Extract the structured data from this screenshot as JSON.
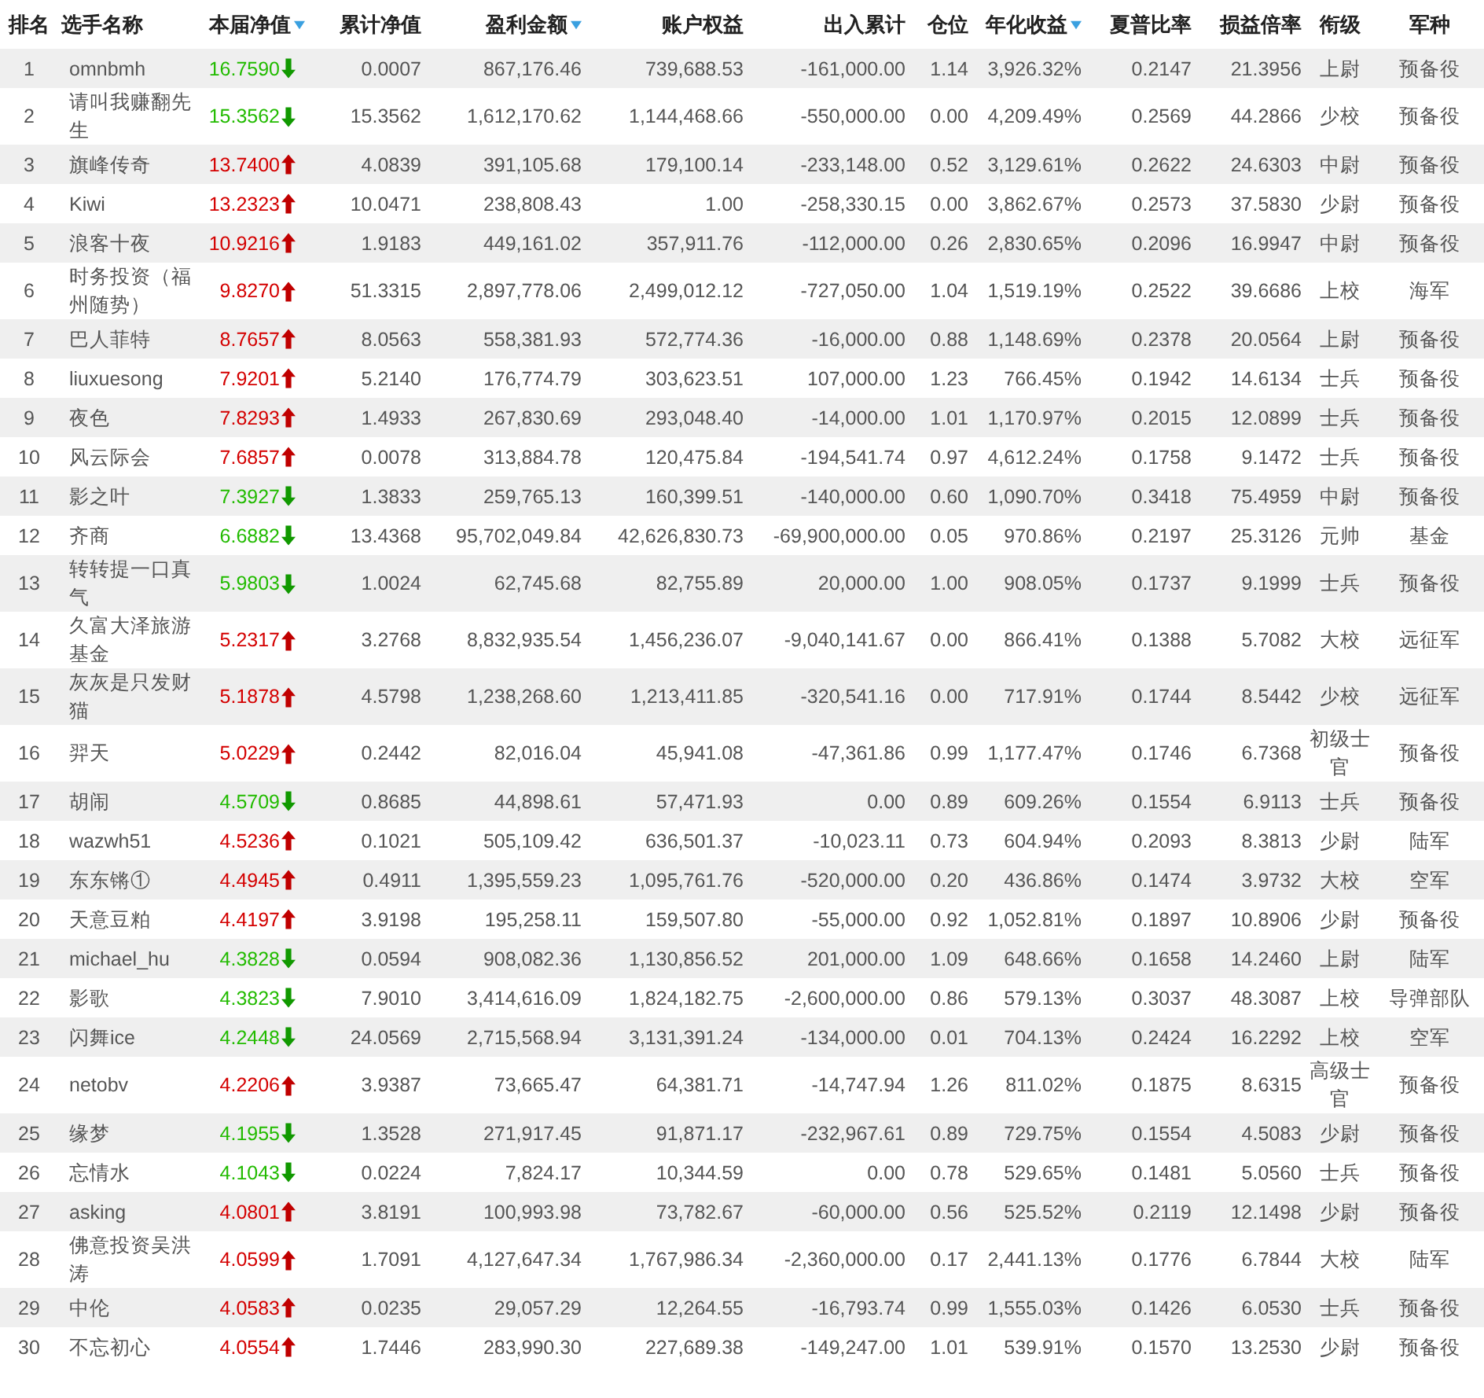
{
  "table": {
    "columns": [
      {
        "label": "排名",
        "sortable": false
      },
      {
        "label": "选手名称",
        "sortable": false
      },
      {
        "label": "本届净值",
        "sortable": true
      },
      {
        "label": "累计净值",
        "sortable": false
      },
      {
        "label": "盈利金额",
        "sortable": true
      },
      {
        "label": "账户权益",
        "sortable": false
      },
      {
        "label": "出入累计",
        "sortable": false
      },
      {
        "label": "仓位",
        "sortable": false
      },
      {
        "label": "年化收益",
        "sortable": true
      },
      {
        "label": "夏普比率",
        "sortable": false
      },
      {
        "label": "损益倍率",
        "sortable": false
      },
      {
        "label": "衔级",
        "sortable": false
      },
      {
        "label": "军种",
        "sortable": false
      }
    ],
    "rows": [
      {
        "rising": false,
        "cells": [
          "1",
          "omnbmh",
          "16.7590",
          "0.0007",
          "867,176.46",
          "739,688.53",
          "-161,000.00",
          "1.14",
          "3,926.32%",
          "0.2147",
          "21.3956",
          "上尉",
          "预备役"
        ]
      },
      {
        "rising": false,
        "cells": [
          "2",
          "请叫我赚翻先生",
          "15.3562",
          "15.3562",
          "1,612,170.62",
          "1,144,468.66",
          "-550,000.00",
          "0.00",
          "4,209.49%",
          "0.2569",
          "44.2866",
          "少校",
          "预备役"
        ]
      },
      {
        "rising": true,
        "cells": [
          "3",
          "旗峰传奇",
          "13.7400",
          "4.0839",
          "391,105.68",
          "179,100.14",
          "-233,148.00",
          "0.52",
          "3,129.61%",
          "0.2622",
          "24.6303",
          "中尉",
          "预备役"
        ]
      },
      {
        "rising": true,
        "cells": [
          "4",
          "Kiwi",
          "13.2323",
          "10.0471",
          "238,808.43",
          "1.00",
          "-258,330.15",
          "0.00",
          "3,862.67%",
          "0.2573",
          "37.5830",
          "少尉",
          "预备役"
        ]
      },
      {
        "rising": true,
        "cells": [
          "5",
          "浪客十夜",
          "10.9216",
          "1.9183",
          "449,161.02",
          "357,911.76",
          "-112,000.00",
          "0.26",
          "2,830.65%",
          "0.2096",
          "16.9947",
          "中尉",
          "预备役"
        ]
      },
      {
        "rising": true,
        "cells": [
          "6",
          "时务投资（福州随势）",
          "9.8270",
          "51.3315",
          "2,897,778.06",
          "2,499,012.12",
          "-727,050.00",
          "1.04",
          "1,519.19%",
          "0.2522",
          "39.6686",
          "上校",
          "海军"
        ]
      },
      {
        "rising": true,
        "cells": [
          "7",
          "巴人菲特",
          "8.7657",
          "8.0563",
          "558,381.93",
          "572,774.36",
          "-16,000.00",
          "0.88",
          "1,148.69%",
          "0.2378",
          "20.0564",
          "上尉",
          "预备役"
        ]
      },
      {
        "rising": true,
        "cells": [
          "8",
          "liuxuesong",
          "7.9201",
          "5.2140",
          "176,774.79",
          "303,623.51",
          "107,000.00",
          "1.23",
          "766.45%",
          "0.1942",
          "14.6134",
          "士兵",
          "预备役"
        ]
      },
      {
        "rising": true,
        "cells": [
          "9",
          "夜色",
          "7.8293",
          "1.4933",
          "267,830.69",
          "293,048.40",
          "-14,000.00",
          "1.01",
          "1,170.97%",
          "0.2015",
          "12.0899",
          "士兵",
          "预备役"
        ]
      },
      {
        "rising": true,
        "cells": [
          "10",
          "风云际会",
          "7.6857",
          "0.0078",
          "313,884.78",
          "120,475.84",
          "-194,541.74",
          "0.97",
          "4,612.24%",
          "0.1758",
          "9.1472",
          "士兵",
          "预备役"
        ]
      },
      {
        "rising": false,
        "cells": [
          "11",
          "影之叶",
          "7.3927",
          "1.3833",
          "259,765.13",
          "160,399.51",
          "-140,000.00",
          "0.60",
          "1,090.70%",
          "0.3418",
          "75.4959",
          "中尉",
          "预备役"
        ]
      },
      {
        "rising": false,
        "cells": [
          "12",
          "齐商",
          "6.6882",
          "13.4368",
          "95,702,049.84",
          "42,626,830.73",
          "-69,900,000.00",
          "0.05",
          "970.86%",
          "0.2197",
          "25.3126",
          "元帅",
          "基金"
        ]
      },
      {
        "rising": false,
        "cells": [
          "13",
          "转转提一口真气",
          "5.9803",
          "1.0024",
          "62,745.68",
          "82,755.89",
          "20,000.00",
          "1.00",
          "908.05%",
          "0.1737",
          "9.1999",
          "士兵",
          "预备役"
        ]
      },
      {
        "rising": true,
        "cells": [
          "14",
          "久富大泽旅游基金",
          "5.2317",
          "3.2768",
          "8,832,935.54",
          "1,456,236.07",
          "-9,040,141.67",
          "0.00",
          "866.41%",
          "0.1388",
          "5.7082",
          "大校",
          "远征军"
        ]
      },
      {
        "rising": true,
        "cells": [
          "15",
          "灰灰是只发财猫",
          "5.1878",
          "4.5798",
          "1,238,268.60",
          "1,213,411.85",
          "-320,541.16",
          "0.00",
          "717.91%",
          "0.1744",
          "8.5442",
          "少校",
          "远征军"
        ]
      },
      {
        "rising": true,
        "cells": [
          "16",
          "羿天",
          "5.0229",
          "0.2442",
          "82,016.04",
          "45,941.08",
          "-47,361.86",
          "0.99",
          "1,177.47%",
          "0.1746",
          "6.7368",
          "初级士官",
          "预备役"
        ]
      },
      {
        "rising": false,
        "cells": [
          "17",
          "胡闹",
          "4.5709",
          "0.8685",
          "44,898.61",
          "57,471.93",
          "0.00",
          "0.89",
          "609.26%",
          "0.1554",
          "6.9113",
          "士兵",
          "预备役"
        ]
      },
      {
        "rising": true,
        "cells": [
          "18",
          "wazwh51",
          "4.5236",
          "0.1021",
          "505,109.42",
          "636,501.37",
          "-10,023.11",
          "0.73",
          "604.94%",
          "0.2093",
          "8.3813",
          "少尉",
          "陆军"
        ]
      },
      {
        "rising": true,
        "cells": [
          "19",
          "东东锵①",
          "4.4945",
          "0.4911",
          "1,395,559.23",
          "1,095,761.76",
          "-520,000.00",
          "0.20",
          "436.86%",
          "0.1474",
          "3.9732",
          "大校",
          "空军"
        ]
      },
      {
        "rising": true,
        "cells": [
          "20",
          "天意豆粕",
          "4.4197",
          "3.9198",
          "195,258.11",
          "159,507.80",
          "-55,000.00",
          "0.92",
          "1,052.81%",
          "0.1897",
          "10.8906",
          "少尉",
          "预备役"
        ]
      },
      {
        "rising": false,
        "cells": [
          "21",
          "michael_hu",
          "4.3828",
          "0.0594",
          "908,082.36",
          "1,130,856.52",
          "201,000.00",
          "1.09",
          "648.66%",
          "0.1658",
          "14.2460",
          "上尉",
          "陆军"
        ]
      },
      {
        "rising": false,
        "cells": [
          "22",
          "影歌",
          "4.3823",
          "7.9010",
          "3,414,616.09",
          "1,824,182.75",
          "-2,600,000.00",
          "0.86",
          "579.13%",
          "0.3037",
          "48.3087",
          "上校",
          "导弹部队"
        ]
      },
      {
        "rising": false,
        "cells": [
          "23",
          "闪舞ice",
          "4.2448",
          "24.0569",
          "2,715,568.94",
          "3,131,391.24",
          "-134,000.00",
          "0.01",
          "704.13%",
          "0.2424",
          "16.2292",
          "上校",
          "空军"
        ]
      },
      {
        "rising": true,
        "cells": [
          "24",
          "netobv",
          "4.2206",
          "3.9387",
          "73,665.47",
          "64,381.71",
          "-14,747.94",
          "1.26",
          "811.02%",
          "0.1875",
          "8.6315",
          "高级士官",
          "预备役"
        ]
      },
      {
        "rising": false,
        "cells": [
          "25",
          "缘梦",
          "4.1955",
          "1.3528",
          "271,917.45",
          "91,871.17",
          "-232,967.61",
          "0.89",
          "729.75%",
          "0.1554",
          "4.5083",
          "少尉",
          "预备役"
        ]
      },
      {
        "rising": false,
        "cells": [
          "26",
          "忘情水",
          "4.1043",
          "0.0224",
          "7,824.17",
          "10,344.59",
          "0.00",
          "0.78",
          "529.65%",
          "0.1481",
          "5.0560",
          "士兵",
          "预备役"
        ]
      },
      {
        "rising": true,
        "cells": [
          "27",
          "asking",
          "4.0801",
          "3.8191",
          "100,993.98",
          "73,782.67",
          "-60,000.00",
          "0.56",
          "525.52%",
          "0.2119",
          "12.1498",
          "少尉",
          "预备役"
        ]
      },
      {
        "rising": true,
        "cells": [
          "28",
          "佛意投资吴洪涛",
          "4.0599",
          "1.7091",
          "4,127,647.34",
          "1,767,986.34",
          "-2,360,000.00",
          "0.17",
          "2,441.13%",
          "0.1776",
          "6.7844",
          "大校",
          "陆军"
        ]
      },
      {
        "rising": true,
        "cells": [
          "29",
          "中伦",
          "4.0583",
          "0.0235",
          "29,057.29",
          "12,264.55",
          "-16,793.74",
          "0.99",
          "1,555.03%",
          "0.1426",
          "6.0530",
          "士兵",
          "预备役"
        ]
      },
      {
        "rising": true,
        "cells": [
          "30",
          "不忘初心",
          "4.0554",
          "1.7446",
          "283,990.30",
          "227,689.38",
          "-149,247.00",
          "1.01",
          "539.91%",
          "0.1570",
          "13.2530",
          "少尉",
          "预备役"
        ]
      }
    ]
  }
}
